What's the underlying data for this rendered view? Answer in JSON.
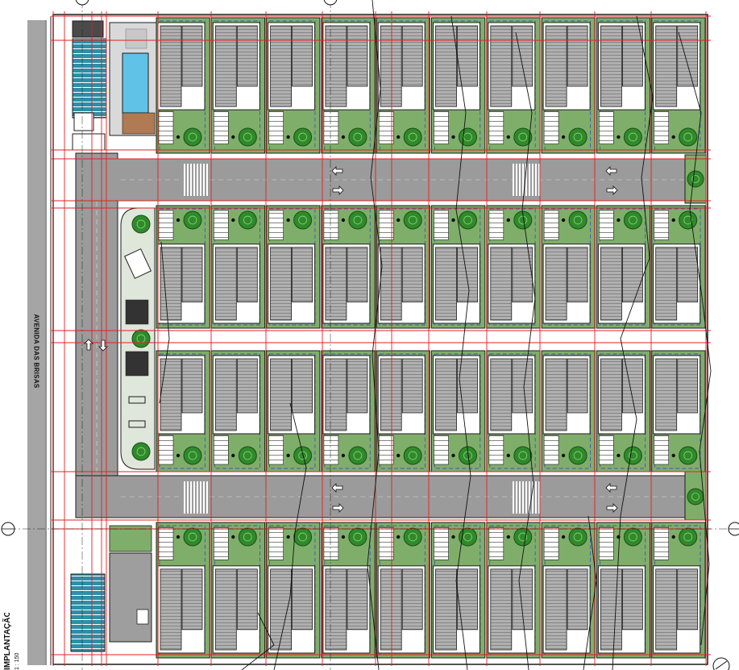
{
  "drawing": {
    "street_label": "AVENIDA DAS BRISAS",
    "title": "IMPLANTAÇÃO",
    "scale": "1 : 150"
  },
  "colors": {
    "lawn": "#7fae6a",
    "lawn_dark": "#6a9a58",
    "road": "#9b9b9b",
    "roof": "#a8a8a8",
    "outline": "#1c1c1c",
    "grid_line": "#e02020",
    "setback_line": "#2a3fd6",
    "tree": "#2f8a2a",
    "pool": "#5fc2e6",
    "playground": "#dfe6da"
  },
  "icons": [
    "tree-icon",
    "arrow-icon",
    "grid-bubble-icon",
    "north-arrow-icon"
  ]
}
